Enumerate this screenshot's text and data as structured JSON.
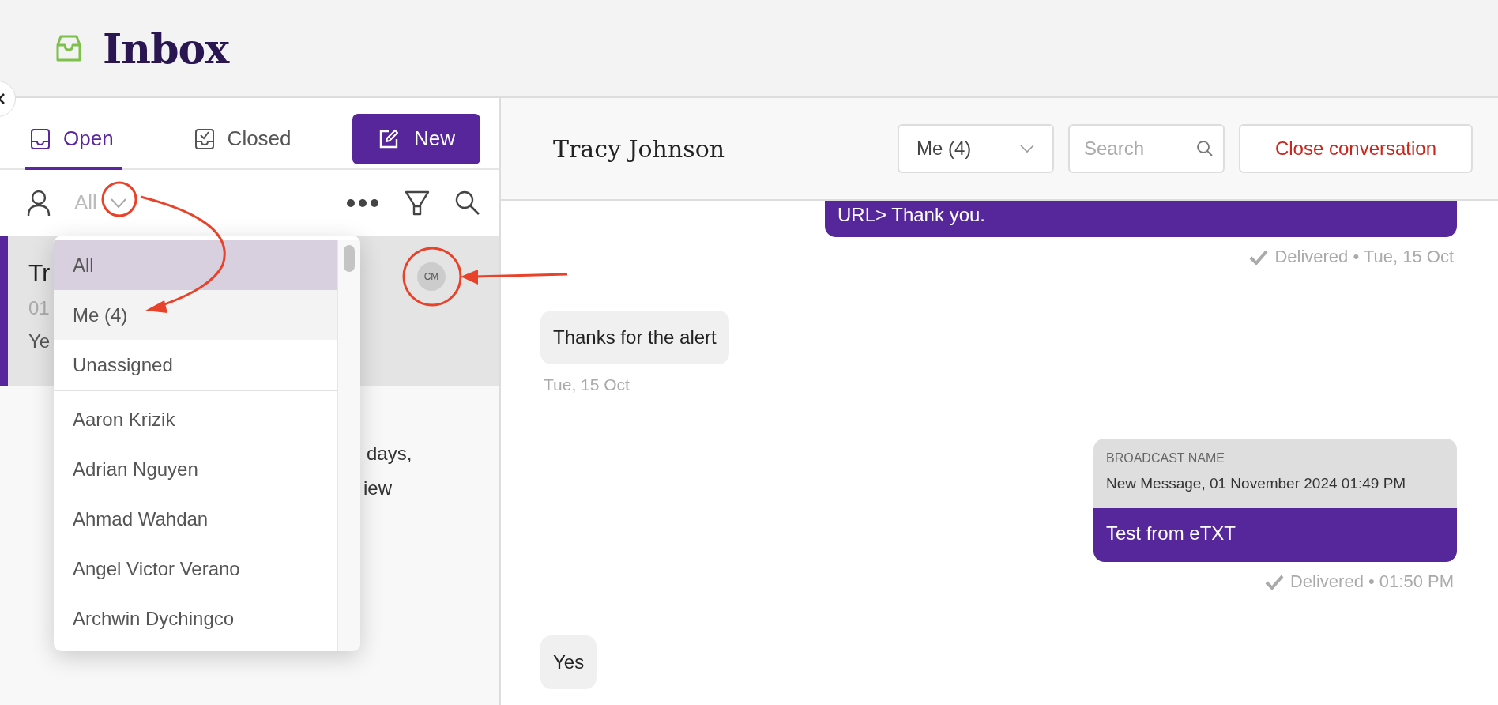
{
  "header": {
    "title": "Inbox"
  },
  "left_panel": {
    "tabs": [
      {
        "label": "Open",
        "selected": true
      },
      {
        "label": "Closed",
        "selected": false
      }
    ],
    "new_button": "New",
    "filter": {
      "value": "All"
    },
    "conversation": {
      "name": "Tr",
      "date": "01",
      "preview": "Ye",
      "avatar": "CM",
      "selected": true
    },
    "preview_lines": [
      "days,",
      "iew"
    ]
  },
  "assignee_dropdown": {
    "groups": [
      [
        {
          "label": "All",
          "selected": true,
          "hovered": false
        },
        {
          "label": "Me (4)",
          "selected": false,
          "hovered": true
        },
        {
          "label": "Unassigned",
          "selected": false,
          "hovered": false
        }
      ],
      [
        {
          "label": "Aaron Krizik",
          "selected": false,
          "hovered": false
        },
        {
          "label": "Adrian Nguyen",
          "selected": false,
          "hovered": false
        },
        {
          "label": "Ahmad Wahdan",
          "selected": false,
          "hovered": false
        },
        {
          "label": "Angel Victor Verano",
          "selected": false,
          "hovered": false
        },
        {
          "label": "Archwin Dychingco",
          "selected": false,
          "hovered": false
        }
      ]
    ]
  },
  "conversation": {
    "title": "Tracy Johnson",
    "assignee": "Me (4)",
    "search_placeholder": "Search",
    "close_button": "Close conversation",
    "messages": [
      {
        "kind": "outgoing",
        "text": "URL> Thank you.",
        "status": "Delivered • Tue, 15 Oct"
      },
      {
        "kind": "incoming",
        "text": "Thanks for the alert",
        "time": "Tue, 15 Oct"
      },
      {
        "kind": "broadcast",
        "label": "BROADCAST NAME",
        "name": "New Message, 01 November 2024 01:49 PM",
        "text": "Test from eTXT",
        "status": "Delivered • 01:50 PM"
      },
      {
        "kind": "incoming",
        "text": "Yes"
      }
    ]
  }
}
